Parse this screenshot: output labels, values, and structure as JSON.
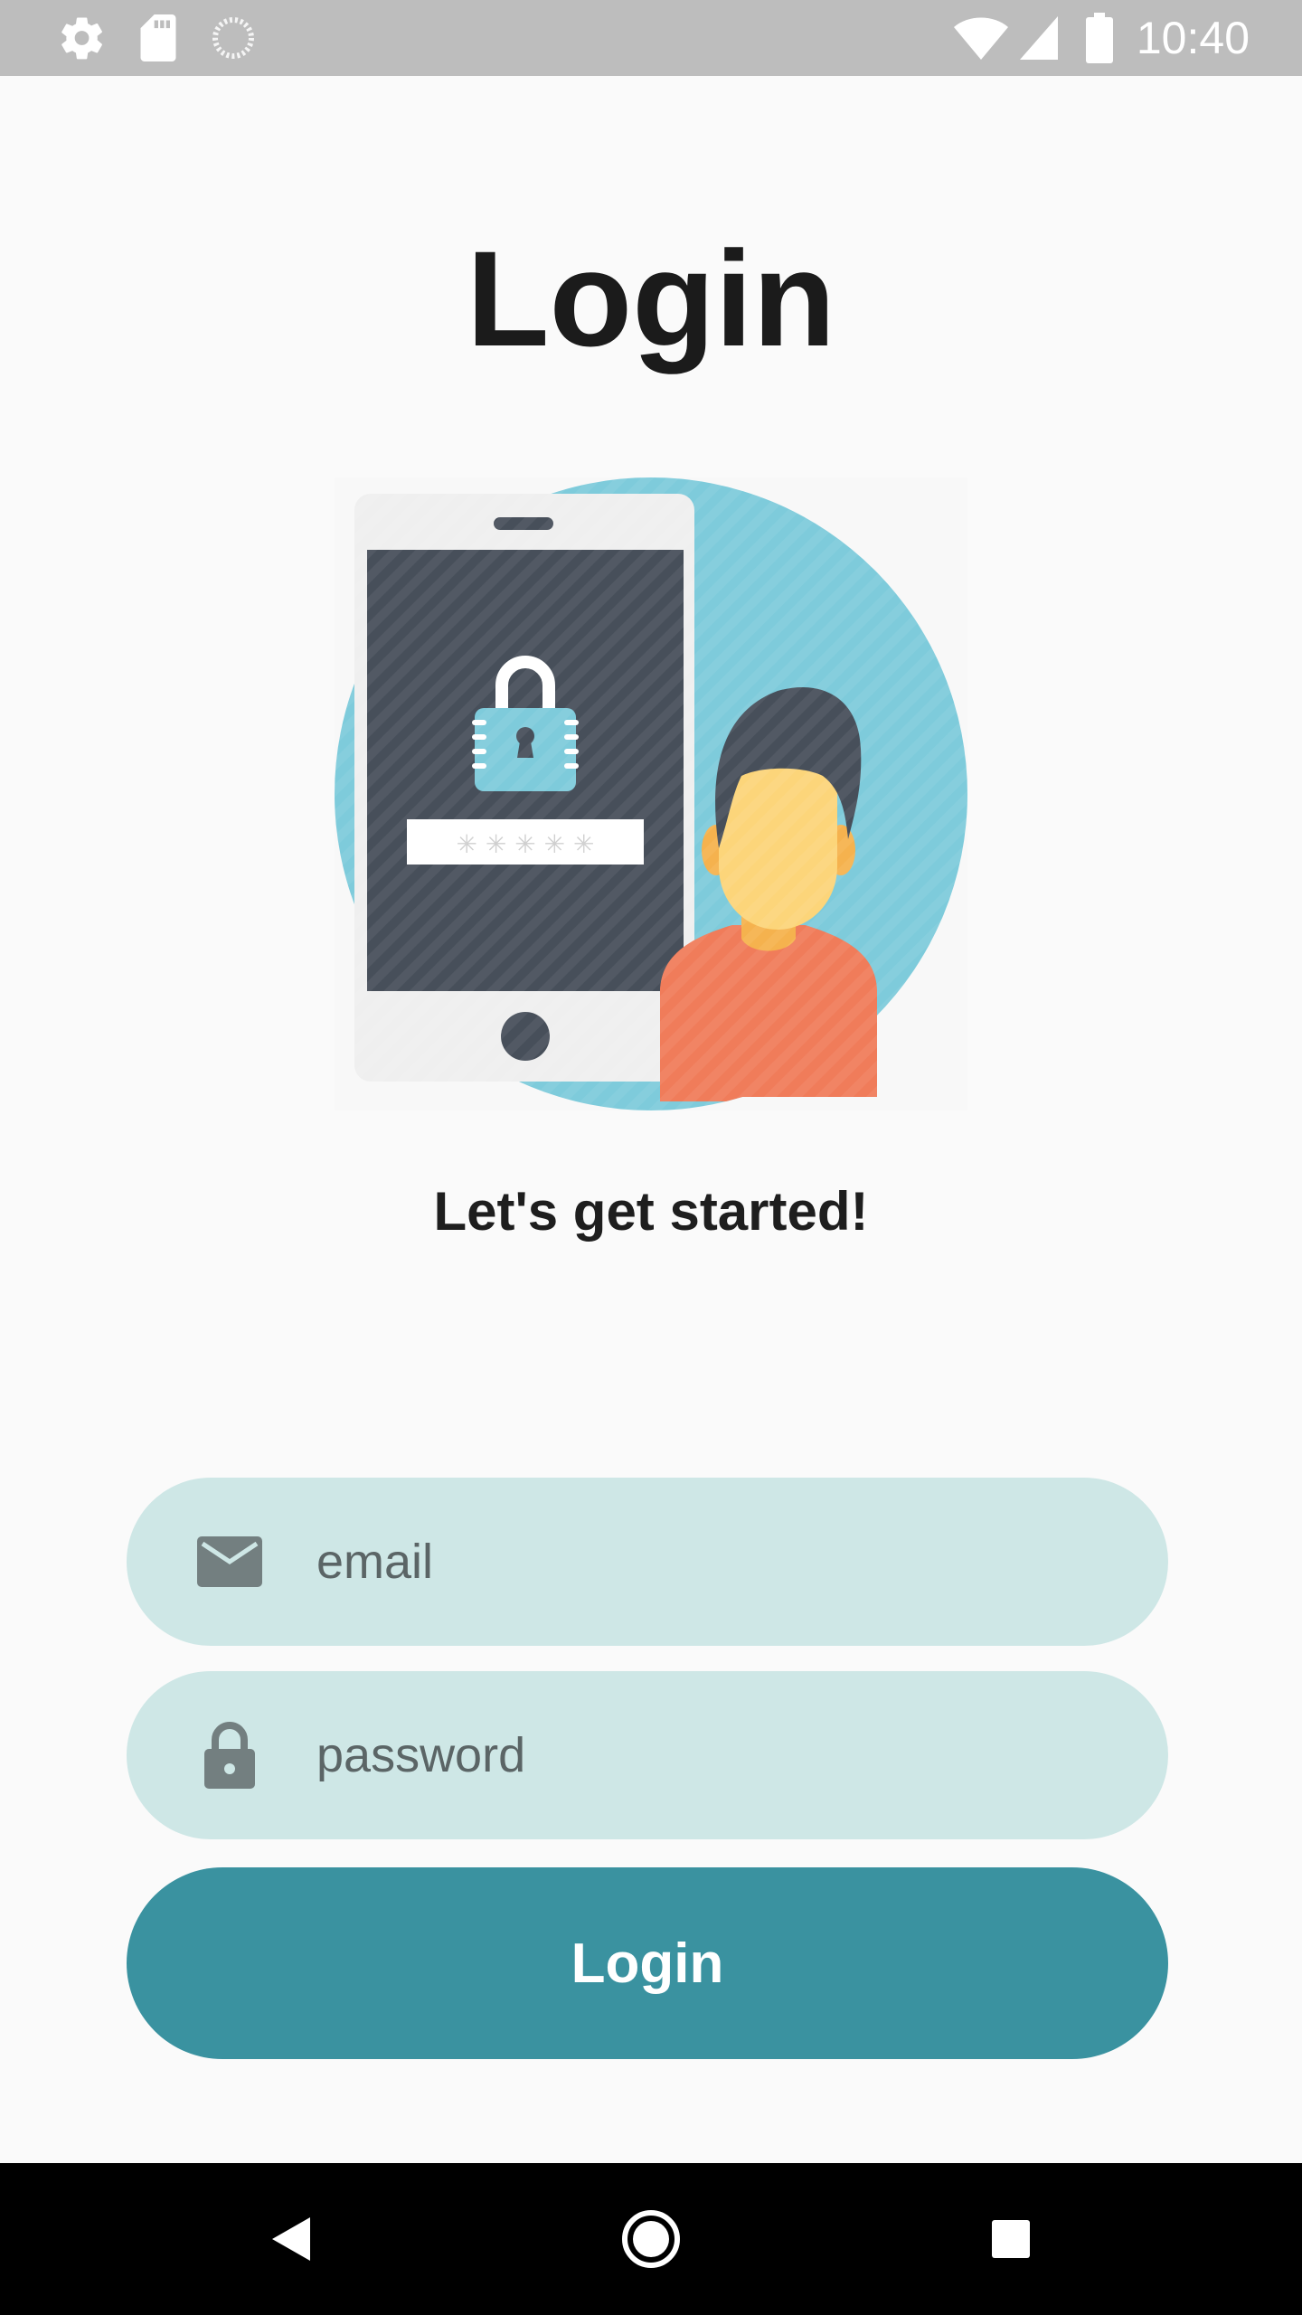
{
  "status_bar": {
    "time": "10:40",
    "icons": [
      "settings-icon",
      "sd-card-icon",
      "sync-icon",
      "wifi-icon",
      "cell-signal-icon",
      "battery-icon"
    ]
  },
  "page": {
    "title": "Login",
    "subtitle": "Let's get started!"
  },
  "illustration": {
    "name": "phone-lock-user-illustration",
    "password_mask": "✳ ✳ ✳ ✳ ✳"
  },
  "form": {
    "email": {
      "icon": "mail-icon",
      "placeholder": "email",
      "value": ""
    },
    "password": {
      "icon": "lock-icon",
      "placeholder": "password",
      "value": ""
    },
    "submit_label": "Login"
  },
  "nav_bar": {
    "buttons": [
      "back-icon",
      "home-icon",
      "recents-icon"
    ]
  },
  "colors": {
    "status_bar": "#bdbdbd",
    "background": "#fafafa",
    "field_bg": "#cee7e6",
    "button_bg": "#3a92a0",
    "illustration_circle": "#7ecbdb",
    "shirt": "#f07c5a",
    "skin": "#fcd57a",
    "phone_screen": "#474f5a"
  }
}
